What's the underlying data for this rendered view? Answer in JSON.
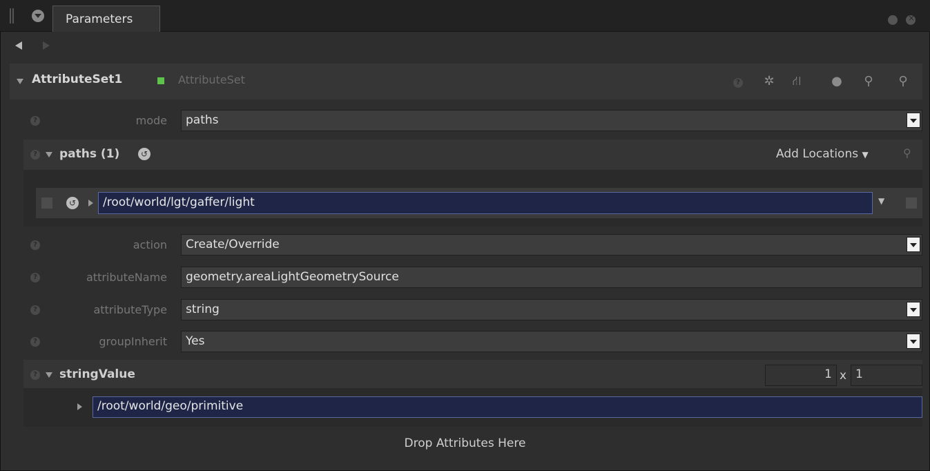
{
  "tab": {
    "title": "Parameters"
  },
  "node": {
    "name": "AttributeSet1",
    "type": "AttributeSet",
    "status_color": "#5ec34a"
  },
  "toolbar_icons": [
    "help-icon",
    "gear-icon",
    "node-graph-icon",
    "comment-icon",
    "wrench-icon",
    "search-icon"
  ],
  "params": {
    "mode": {
      "label": "mode",
      "value": "paths"
    },
    "paths": {
      "label": "paths (1)",
      "add_locations": "Add Locations",
      "items": [
        "/root/world/lgt/gaffer/light"
      ]
    },
    "action": {
      "label": "action",
      "value": "Create/Override"
    },
    "attributeName": {
      "label": "attributeName",
      "value": "geometry.areaLightGeometrySource"
    },
    "attributeType": {
      "label": "attributeType",
      "value": "string"
    },
    "groupInherit": {
      "label": "groupInherit",
      "value": "Yes"
    },
    "stringValue": {
      "label": "stringValue",
      "rows": "1",
      "times": "x",
      "cols": "1",
      "items": [
        "/root/world/geo/primitive"
      ]
    }
  },
  "drop_hint": "Drop Attributes Here",
  "colors": {
    "selection_bg": "#1f2547",
    "panel_bg": "#2e2e2e"
  }
}
